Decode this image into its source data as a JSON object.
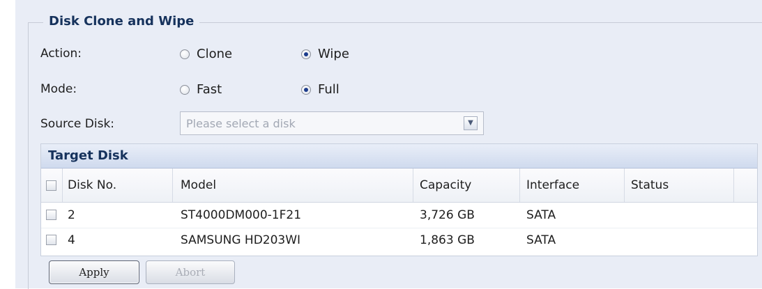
{
  "section": {
    "title": "Disk Clone and Wipe"
  },
  "action": {
    "label": "Action:",
    "options": [
      {
        "label": "Clone",
        "selected": false
      },
      {
        "label": "Wipe",
        "selected": true
      }
    ]
  },
  "mode": {
    "label": "Mode:",
    "options": [
      {
        "label": "Fast",
        "selected": false
      },
      {
        "label": "Full",
        "selected": true
      }
    ]
  },
  "source_disk": {
    "label": "Source Disk:",
    "placeholder": "Please select a disk"
  },
  "target_disk": {
    "title": "Target Disk",
    "columns": [
      "Disk No.",
      "Model",
      "Capacity",
      "Interface",
      "Status"
    ],
    "rows": [
      {
        "disk_no": "2",
        "model": "ST4000DM000-1F21",
        "capacity": "3,726 GB",
        "interface": "SATA",
        "status": "",
        "checked": false
      },
      {
        "disk_no": "4",
        "model": "SAMSUNG HD203WI",
        "capacity": "1,863 GB",
        "interface": "SATA",
        "status": "",
        "checked": false
      }
    ]
  },
  "buttons": {
    "apply": "Apply",
    "abort": "Abort"
  },
  "colors": {
    "panel_bg": "#e9edf6",
    "heading": "#16325c",
    "radio_selected": "#1c3c8c"
  }
}
